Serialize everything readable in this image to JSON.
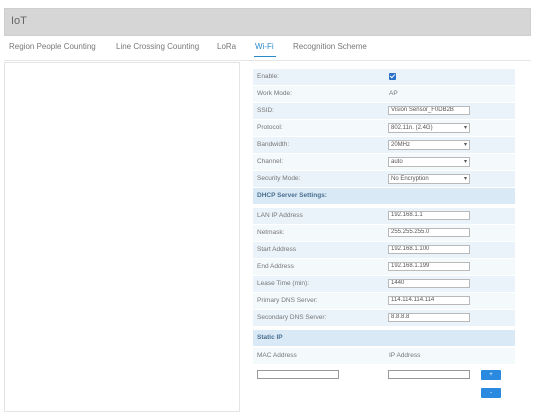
{
  "window": {
    "title": "IoT"
  },
  "tabs": [
    {
      "label": "Region People Counting",
      "active": false
    },
    {
      "label": "Line Crossing Counting",
      "active": false
    },
    {
      "label": "LoRa",
      "active": false
    },
    {
      "label": "Wi-Fi",
      "active": true
    },
    {
      "label": "Recognition Scheme",
      "active": false
    }
  ],
  "wifi": {
    "enable": {
      "label": "Enable:",
      "checked": true
    },
    "work_mode": {
      "label": "Work Mode:",
      "value": "AP"
    },
    "ssid": {
      "label": "SSID:",
      "value": "Vision Sensor_F0DB2B"
    },
    "protocol": {
      "label": "Protocol:",
      "value": "802.11n. (2.4G)"
    },
    "bandwidth": {
      "label": "Bandwidth:",
      "value": "20MHz"
    },
    "channel": {
      "label": "Channel:",
      "value": "auto"
    },
    "security_mode": {
      "label": "Security Mode:",
      "value": "No Encryption"
    }
  },
  "dhcp": {
    "section_title": "DHCP Server Settings:",
    "lan_ip": {
      "label": "LAN IP Address",
      "value": "192.168.1.1"
    },
    "netmask": {
      "label": "Netmask:",
      "value": "255.255.255.0"
    },
    "start_address": {
      "label": "Start Address",
      "value": "192.168.1.100"
    },
    "end_address": {
      "label": "End Address",
      "value": "192.168.1.199"
    },
    "lease_time": {
      "label": "Lease Time (min):",
      "value": "1440"
    },
    "primary_dns": {
      "label": "Primary DNS Server:",
      "value": "114.114.114.114"
    },
    "secondary_dns": {
      "label": "Secondary DNS Server:",
      "value": "8.8.8.8"
    }
  },
  "static_ip": {
    "section_title": "Static IP",
    "mac_header": "MAC Address",
    "ip_header": "IP Address",
    "mac_value": "",
    "ip_value": "",
    "add_button": "+",
    "delete_button": "-"
  },
  "colors": {
    "accent": "#2a8ac8",
    "button": "#2a8ae0",
    "row_tint": "#eaf3fa",
    "section_tint": "#d9e9f6"
  }
}
